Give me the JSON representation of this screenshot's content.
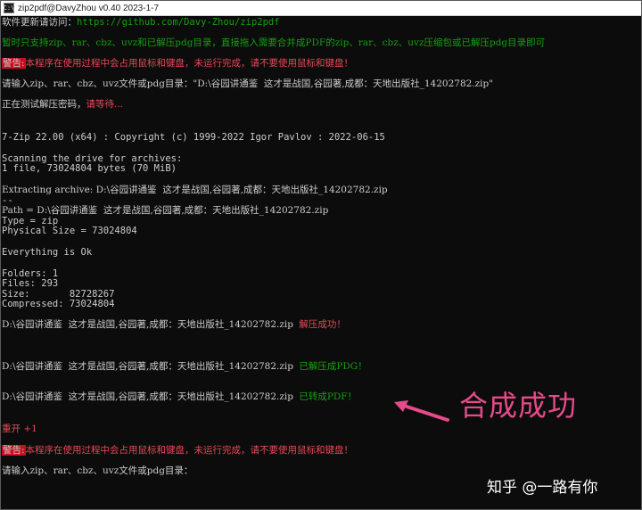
{
  "window": {
    "title": "zip2pdf@DavyZhou v0.40 2023-1-7",
    "icon_glyph": "C:\\"
  },
  "console": {
    "update_label": "软件更新请访问：",
    "update_url": "https://github.com/Davy-Zhou/zip2pdf",
    "support_line": "暂时只支持zip、rar、cbz、uvz和已解压pdg目录，直接拖入需要合并成PDF的zip、rar、cbz、uvz压缩包或已解压pdg目录即可",
    "warn_tag": "警告:",
    "warn_text": "本程序在使用过程中会占用鼠标和键盘，未运行完成，请不要使用鼠标和键盘！",
    "input_prompt": "请输入zip、rar、cbz、uvz文件或pdg目录：\"D:\\谷园讲通鉴  这才是战国,谷园著,成都：天地出版社_14202782.zip\"",
    "testing_label": "正在测试解压密码，",
    "testing_wait": "请等待...",
    "zip_header": "7-Zip 22.00 (x64) : Copyright (c) 1999-2022 Igor Pavlov : 2022-06-15",
    "scanning": "Scanning the drive for archives:",
    "file_count": "1 file, 73024804 bytes (70 MiB)",
    "extracting": "Extracting archive: D:\\谷园讲通鉴  这才是战国,谷园著,成都：天地出版社_14202782.zip",
    "separator": "--",
    "path_line": "Path = D:\\谷园讲通鉴  这才是战国,谷园著,成都：天地出版社_14202782.zip",
    "type_line": "Type = zip",
    "physical_size": "Physical Size = 73024804",
    "everything_ok": "Everything is Ok",
    "folders": "Folders: 1",
    "files": "Files: 293",
    "size": "Size:       82728267",
    "compressed": "Compressed: 73024804",
    "file_path": "D:\\谷园讲通鉴  这才是战国,谷园著,成都：天地出版社_14202782.zip",
    "status_unzip": "解压成功！",
    "status_pdg": "已解压成PDG！",
    "status_pdf": "已转成PDF！",
    "retry": "重开 +1",
    "input_prompt_2": "请输入zip、rar、cbz、uvz文件或pdg目录："
  },
  "annotation": {
    "text": "合成成功",
    "color": "#e64a8a"
  },
  "watermark": "知乎 @一路有你",
  "colors": {
    "background": "#0c0c0c",
    "text": "#cccccc",
    "green": "#13a10e",
    "red": "#e74856",
    "warn_bg": "#c50f1f"
  }
}
